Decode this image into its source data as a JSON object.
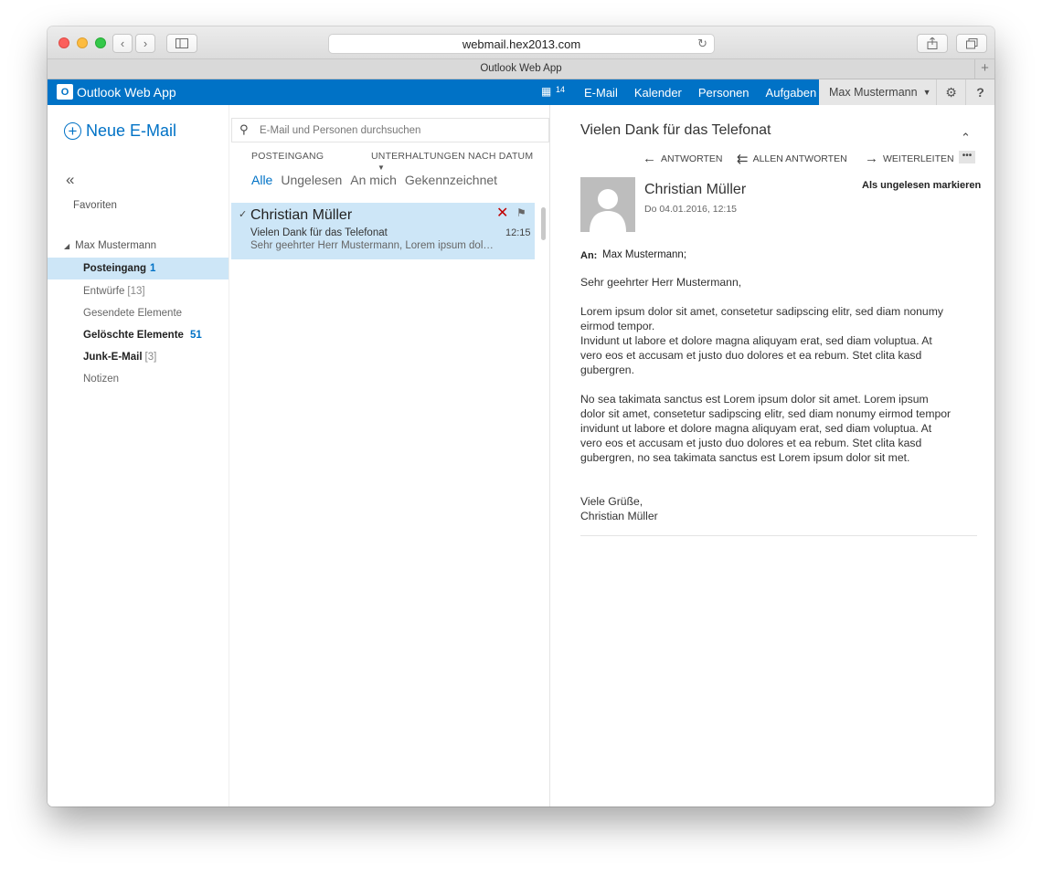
{
  "browser": {
    "url": "webmail.hex2013.com",
    "tab_title": "Outlook Web App"
  },
  "header": {
    "app_name": "Outlook Web App",
    "calendar_count": "14",
    "nav": [
      "E-Mail",
      "Kalender",
      "Personen",
      "Aufgaben"
    ],
    "user_name": "Max Mustermann",
    "help": "?"
  },
  "sidebar": {
    "new_mail": "Neue E-Mail",
    "favorites": "Favoriten",
    "account": "Max Mustermann",
    "folders": [
      {
        "label": "Posteingang",
        "count": "1"
      },
      {
        "label": "Entwürfe",
        "count": "[13]"
      },
      {
        "label": "Gesendete Elemente",
        "count": ""
      },
      {
        "label": "Gelöschte Elemente",
        "count": "51"
      },
      {
        "label": "Junk-E-Mail",
        "count": "[3]"
      },
      {
        "label": "Notizen",
        "count": ""
      }
    ]
  },
  "list": {
    "search_placeholder": "E-Mail und Personen durchsuchen",
    "folder_label": "POSTEINGANG",
    "sort_label": "UNTERHALTUNGEN NACH DATUM",
    "filters": [
      "Alle",
      "Ungelesen",
      "An mich",
      "Gekennzeichnet"
    ],
    "messages": [
      {
        "from": "Christian Müller",
        "subject": "Vielen Dank für das Telefonat",
        "preview": "Sehr geehrter Herr Mustermann,  Lorem ipsum dolor sit amet",
        "time": "12:15"
      }
    ]
  },
  "reading": {
    "subject": "Vielen Dank für das Telefonat",
    "actions": [
      "ANTWORTEN",
      "ALLEN ANTWORTEN",
      "WEITERLEITEN"
    ],
    "sender": "Christian Müller",
    "date": "Do 04.01.2016, 12:15",
    "mark_unread": "Als ungelesen markieren",
    "to_label": "An:",
    "to_value": "Max Mustermann;",
    "greeting": "Sehr geehrter Herr Mustermann,",
    "para1a": "Lorem ipsum dolor sit amet, consetetur sadipscing elitr, sed diam nonumy eirmod tempor.",
    "para1b": "Invidunt ut labore et dolore magna aliquyam erat, sed diam voluptua. At vero eos et accusam et justo duo dolores et ea rebum. Stet clita kasd gubergren.",
    "para2": "No sea takimata sanctus est Lorem ipsum dolor sit amet. Lorem ipsum dolor sit amet, consetetur sadipscing elitr, sed diam nonumy eirmod tempor invidunt ut labore et dolore magna aliquyam erat, sed diam voluptua. At vero eos et accusam et justo duo dolores et ea rebum. Stet clita kasd gubergren, no sea takimata sanctus est Lorem ipsum dolor sit met.",
    "closing": "Viele Grüße,",
    "signature": "Christian Müller"
  },
  "colors": {
    "brand": "#0072c6",
    "selection": "#cde6f7",
    "delete": "#c00000"
  }
}
